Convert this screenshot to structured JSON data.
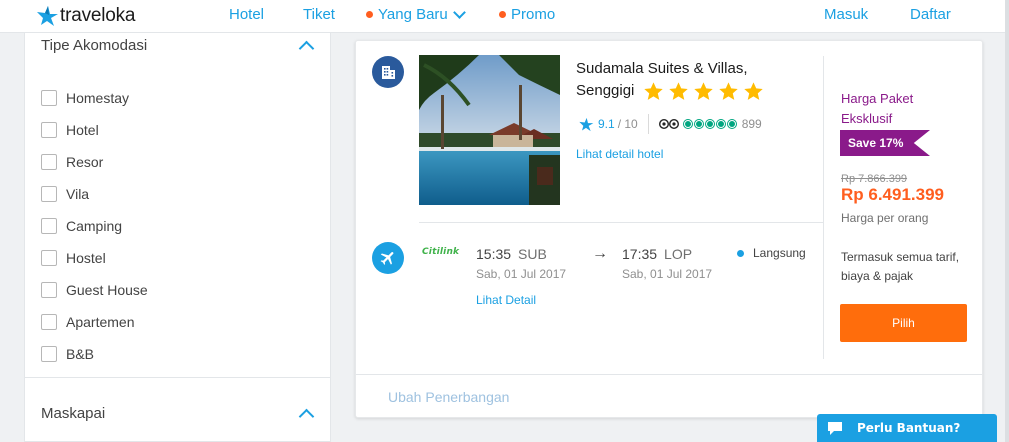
{
  "header": {
    "logo_text": "traveloka",
    "nav": {
      "hotel": "Hotel",
      "tiket": "Tiket",
      "yang_baru": "Yang Baru",
      "promo": "Promo",
      "masuk": "Masuk",
      "daftar": "Daftar"
    }
  },
  "filters": {
    "accommodation": {
      "title": "Tipe Akomodasi",
      "options": [
        "Homestay",
        "Hotel",
        "Resor",
        "Vila",
        "Camping",
        "Hostel",
        "Guest House",
        "Apartemen",
        "B&B"
      ]
    },
    "airline": {
      "title": "Maskapai"
    }
  },
  "package": {
    "hotel": {
      "name": "Sudamala Suites & Villas, Senggigi",
      "stars": 5,
      "rating": "9.1",
      "rating_max": "/ 10",
      "review_count": "899",
      "ta_rating": 5,
      "detail_link": "Lihat detail hotel"
    },
    "flight": {
      "airline": "Citilink",
      "depart_time": "15:35",
      "depart_code": "SUB",
      "depart_date": "Sab, 01 Jul 2017",
      "arrow": "→",
      "arrive_time": "17:35",
      "arrive_code": "LOP",
      "arrive_date": "Sab, 01 Jul 2017",
      "stop_type": "Langsung",
      "detail_link": "Lihat Detail"
    },
    "pricing": {
      "label": "Harga Paket Eksklusif",
      "save_badge": "Save 17%",
      "old_price": "Rp 7.866.399",
      "new_price": "Rp 6.491.399",
      "per_person": "Harga per orang",
      "includes": "Termasuk semua tarif, biaya & pajak",
      "select_button": "Pilih"
    },
    "change_flight": "Ubah Penerbangan"
  },
  "help": {
    "label": "Perlu Bantuan?"
  },
  "colors": {
    "brand_blue": "#1ba0e2",
    "accent_orange": "#ff5e1f",
    "exclusive_purple": "#8a1a8a"
  }
}
